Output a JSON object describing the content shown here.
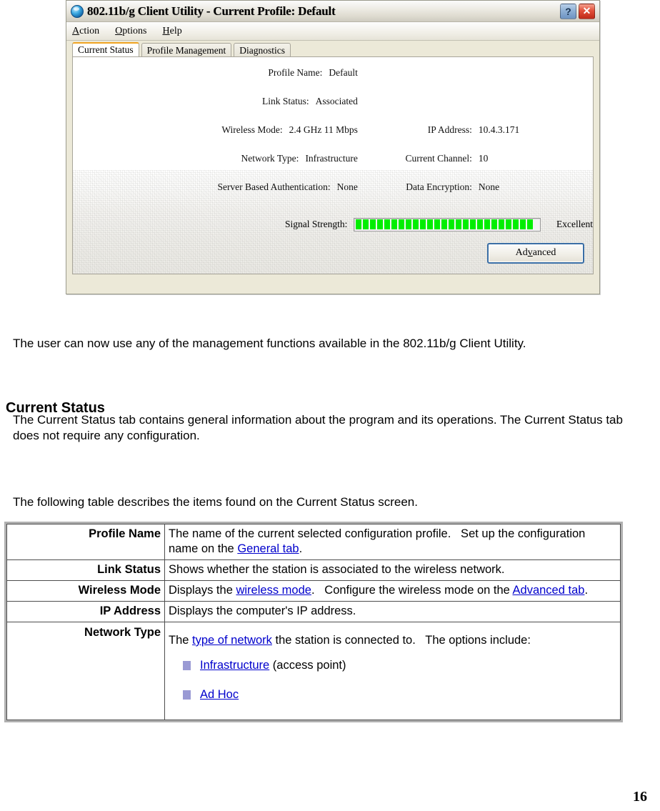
{
  "window": {
    "title": "802.11b/g Client Utility - Current Profile: Default",
    "icon": "globe-icon",
    "help_button": "?",
    "close_button": "✕",
    "menu": [
      {
        "label": "Action",
        "accesskey": "A"
      },
      {
        "label": "Options",
        "accesskey": "O"
      },
      {
        "label": "Help",
        "accesskey": "H"
      }
    ],
    "tabs": [
      {
        "label": "Current Status",
        "active": true
      },
      {
        "label": "Profile Management",
        "active": false
      },
      {
        "label": "Diagnostics",
        "active": false
      }
    ],
    "status": {
      "rows": [
        {
          "left_label": "Profile Name:",
          "left_value": "Default",
          "right_label": "",
          "right_value": ""
        },
        {
          "left_label": "Link Status:",
          "left_value": "Associated",
          "right_label": "",
          "right_value": ""
        },
        {
          "left_label": "Wireless Mode:",
          "left_value": "2.4 GHz 11 Mbps",
          "right_label": "IP Address:",
          "right_value": "10.4.3.171"
        },
        {
          "left_label": "Network Type:",
          "left_value": "Infrastructure",
          "right_label": "Current Channel:",
          "right_value": "10"
        },
        {
          "left_label": "Server Based Authentication:",
          "left_value": "None",
          "right_label": "Data Encryption:",
          "right_value": "None"
        }
      ],
      "signal_label": "Signal Strength:",
      "signal_quality": "Excellent",
      "signal_bars_filled": 25,
      "signal_bars_total": 26,
      "signal_bar_color": "#00ee00"
    },
    "advanced_button": {
      "before": "Ad",
      "accesskey": "v",
      "after": "anced"
    }
  },
  "document": {
    "intro_paragraph": "The user can now use any of the management functions available in the 802.11b/g Client Utility.",
    "section_heading": "Current Status",
    "section_paragraph": "The Current Status tab contains general information about the program and its operations. The Current Status tab does not require any configuration.",
    "table_intro": "The following table describes the items found on the Current Status screen.",
    "page_number": "16",
    "table": {
      "rows": [
        {
          "label": "Profile Name",
          "text_before": "The name of the current selected configuration profile.   Set up the configuration name on the ",
          "link": "General tab",
          "text_after": "."
        },
        {
          "label": "Link Status",
          "text_before": "Shows whether the station is associated to the wireless network.",
          "link": "",
          "text_after": ""
        },
        {
          "label": "Wireless Mode",
          "text_before": "Displays the ",
          "link": "wireless mode",
          "text_mid": ".   Configure the wireless mode on the ",
          "link2": "Advanced tab",
          "text_after": "."
        },
        {
          "label": "IP Address",
          "text_before": "Displays the computer's IP address.",
          "link": "",
          "text_after": ""
        },
        {
          "label": "Network Type",
          "text_before": "The ",
          "link": "type of network",
          "text_after": " the station is connected to.   The options include:",
          "options": [
            {
              "link": "Infrastructure",
              "suffix": " (access point)"
            },
            {
              "link": "Ad Hoc",
              "suffix": ""
            }
          ]
        }
      ]
    }
  },
  "colors": {
    "link": "#0000cc",
    "signal_green": "#00ee00",
    "bullet": "#9a9ad4",
    "tab_active_accent": "#f0a422",
    "close_red": "#bf2a18"
  }
}
